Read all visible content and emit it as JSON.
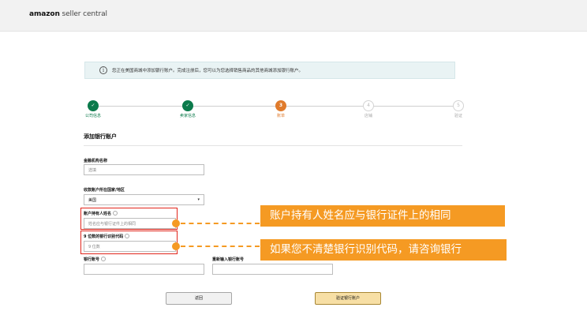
{
  "header": {
    "brand_bold": "amazon",
    "brand_rest": " seller central"
  },
  "info": {
    "icon": "info-icon",
    "text": "您正在美国商城中添加银行账户。完成注册后，您可以为您选择销售商品的其他商城添加银行账户。"
  },
  "steps": [
    {
      "label": "公司信息",
      "state": "done",
      "mark": "✓"
    },
    {
      "label": "卖家信息",
      "state": "done",
      "mark": "✓"
    },
    {
      "label": "账单",
      "state": "current",
      "mark": "3"
    },
    {
      "label": "店铺",
      "state": "todo",
      "mark": "4"
    },
    {
      "label": "验证",
      "state": "todo",
      "mark": "5"
    }
  ],
  "form": {
    "title": "添加银行账户",
    "institution": {
      "label": "金融机构名称",
      "placeholder": "选填"
    },
    "country": {
      "label": "收款账户所在国家/地区",
      "value": "美国"
    },
    "holder": {
      "label": "账户持有人姓名",
      "placeholder": "姓名应与银行证件上的相同"
    },
    "routing": {
      "label": "9 位数的银行识别代码",
      "placeholder": "9 位数"
    },
    "account": {
      "label": "银行账号"
    },
    "account_confirm": {
      "label": "重新输入银行账号"
    }
  },
  "callouts": {
    "holder": "账户持有人姓名应与银行证件上的相同",
    "routing": "如果您不清楚银行识别代码，请咨询银行"
  },
  "buttons": {
    "back": "返回",
    "verify": "验证银行账户"
  },
  "colors": {
    "accent": "#f59a23",
    "success": "#0b7a4b",
    "current": "#e07b2c",
    "highlight": "#e1251b"
  }
}
